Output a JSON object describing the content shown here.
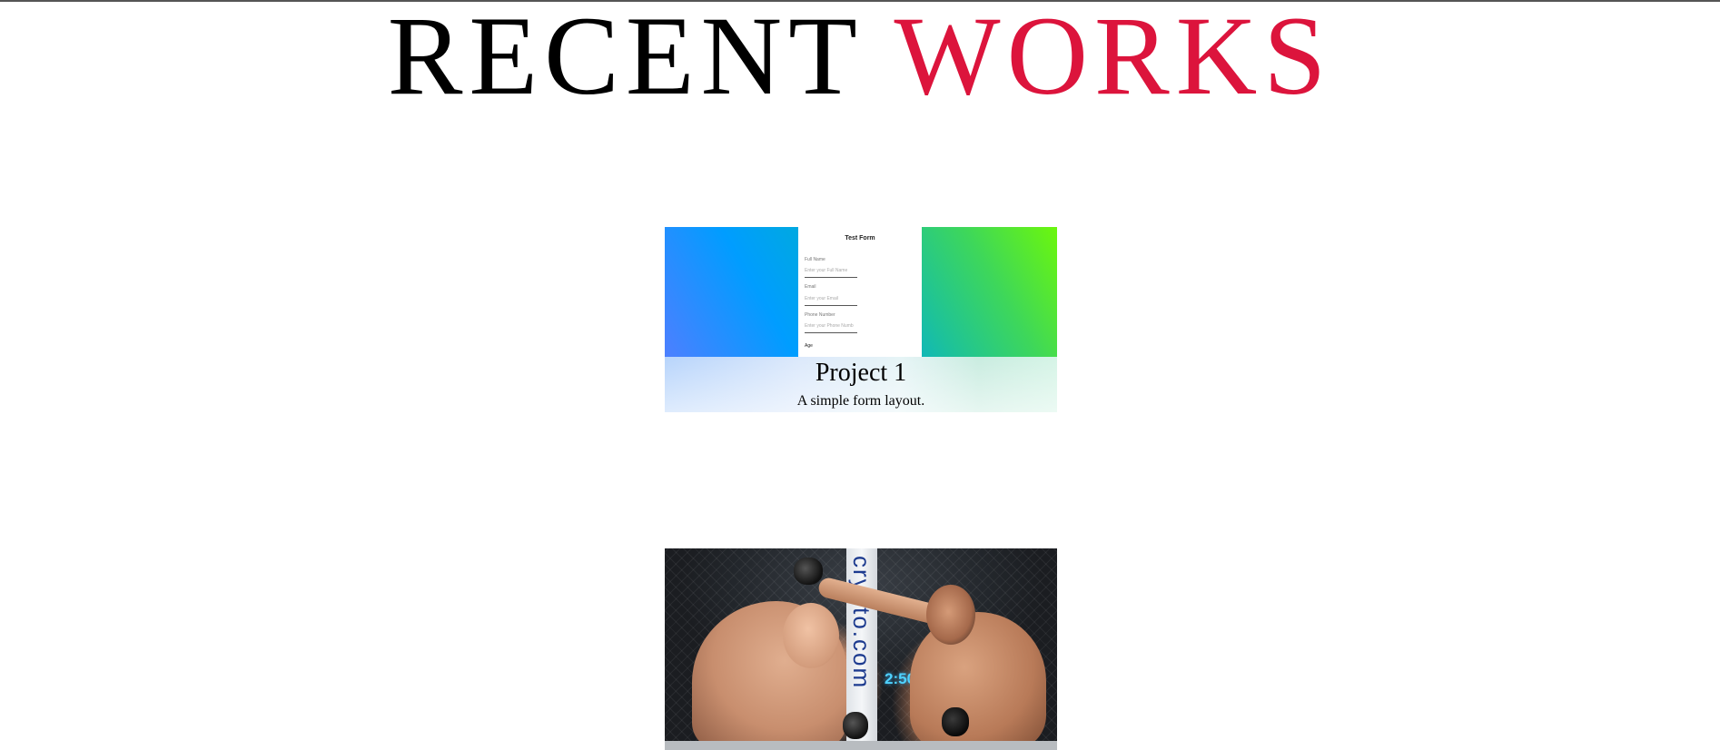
{
  "section": {
    "title_part1": "RECENT",
    "title_part2": "WORKS",
    "accent_color": "#dc143c"
  },
  "projects": [
    {
      "title": "Project 1",
      "description": "A simple form layout.",
      "thumbnail": {
        "form_title": "Test Form",
        "fields": [
          {
            "label": "Full Name",
            "placeholder": "Enter your Full Name"
          },
          {
            "label": "Email",
            "placeholder": "Enter your Email"
          },
          {
            "label": "Phone Number",
            "placeholder": "Enter your Phone Numb"
          }
        ],
        "next_label": "Age"
      }
    },
    {
      "thumbnail": {
        "banner_text": "crypto.com",
        "clock_text": "2:50"
      }
    }
  ]
}
